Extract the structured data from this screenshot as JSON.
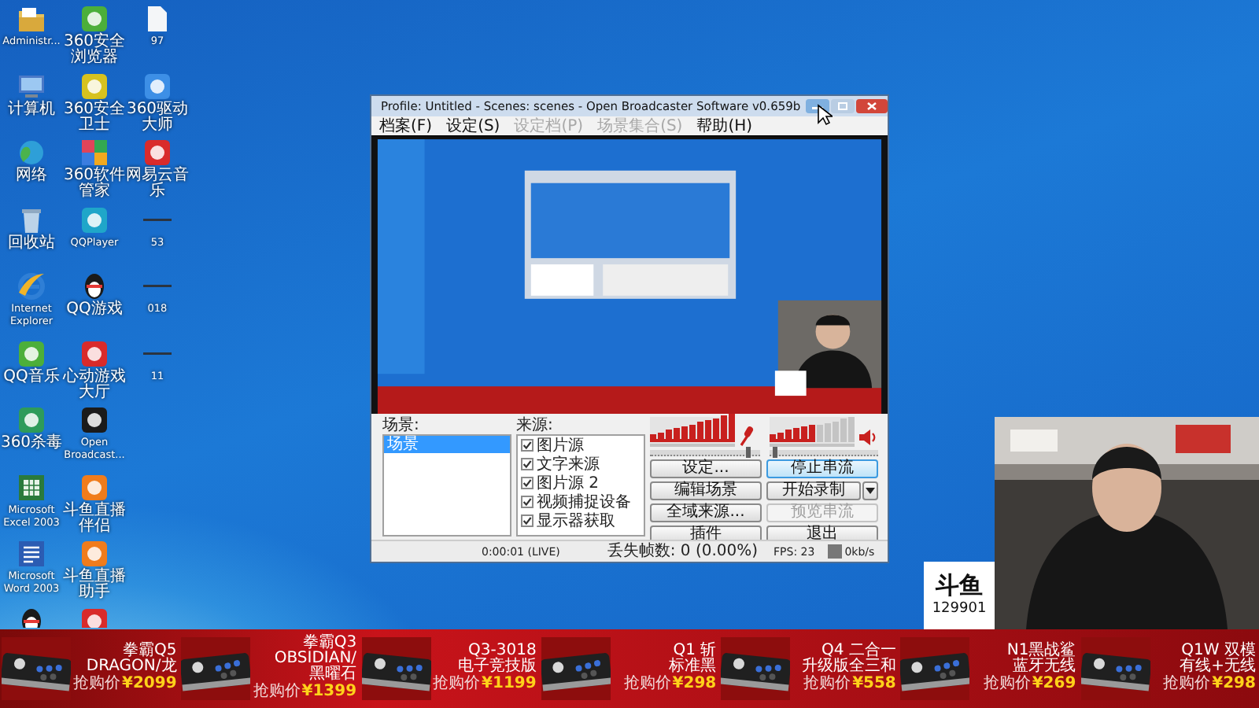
{
  "desktop": {
    "icon_columns": [
      {
        "icons": [
          {
            "kind": "folder",
            "label": "Administr..."
          },
          {
            "kind": "computer",
            "label": "计算机"
          },
          {
            "kind": "globe",
            "label": "网络"
          },
          {
            "kind": "bin",
            "label": "回收站"
          },
          {
            "kind": "ie",
            "label": "Internet Explorer"
          },
          {
            "kind": "green",
            "label": "QQ音乐"
          },
          {
            "kind": "gapp",
            "label": "360杀毒"
          },
          {
            "kind": "excel",
            "label": "Microsoft Excel 2003"
          },
          {
            "kind": "word",
            "label": "Microsoft Word 2003"
          },
          {
            "kind": "penguin"
          }
        ]
      },
      {
        "icons": [
          {
            "kind": "green",
            "label": "360安全浏览器"
          },
          {
            "kind": "yellow",
            "label": "360安全卫士"
          },
          {
            "kind": "tiles",
            "label": "360软件管家"
          },
          {
            "kind": "cyan",
            "label": "QQPlayer"
          },
          {
            "kind": "penguin",
            "label": "QQ游戏"
          },
          {
            "kind": "red",
            "label": "心动游戏大厅"
          },
          {
            "kind": "dark",
            "label": "Open Broadcast..."
          },
          {
            "kind": "orange",
            "label": "斗鱼直播伴侣"
          },
          {
            "kind": "orange",
            "label": "斗鱼直播助手"
          },
          {
            "kind": "red"
          }
        ]
      },
      {
        "icons": [
          {
            "kind": "file",
            "label": "97"
          },
          {
            "kind": "blue",
            "label": "360驱动大师"
          },
          {
            "kind": "red",
            "label": "网易云音乐"
          },
          {
            "kind": "dash",
            "label": "53"
          },
          {
            "kind": "dash",
            "label": "018"
          },
          {
            "kind": "dash",
            "label": "11"
          }
        ]
      }
    ]
  },
  "obs_window": {
    "title": "Profile: Untitled - Scenes: scenes - Open Broadcaster Software v0.659b",
    "menu": [
      {
        "label": "档案(F)",
        "disabled": false
      },
      {
        "label": "设定(S)",
        "disabled": false
      },
      {
        "label": "设定档(P)",
        "disabled": true
      },
      {
        "label": "场景集合(S)",
        "disabled": true
      },
      {
        "label": "帮助(H)",
        "disabled": false
      }
    ],
    "scenes": {
      "label": "场景:",
      "items": [
        {
          "label": "场景",
          "selected": true
        }
      ]
    },
    "sources": {
      "label": "来源:",
      "items": [
        {
          "label": "图片源",
          "checked": true
        },
        {
          "label": "文字来源",
          "checked": true
        },
        {
          "label": "图片源 2",
          "checked": true
        },
        {
          "label": "视频捕捉设备",
          "checked": true
        },
        {
          "label": "显示器获取",
          "checked": true
        }
      ]
    },
    "audio": [
      {
        "kind": "mic",
        "meter": {
          "level": 1
        },
        "slider": {
          "level": 0.88
        }
      },
      {
        "kind": "speaker",
        "meter": {
          "level": 0.55
        },
        "slider": {
          "level": 0.03
        }
      }
    ],
    "buttons": [
      {
        "label": "设定...",
        "kind": "plain",
        "focused": false,
        "disabled": false
      },
      {
        "label": "停止串流",
        "kind": "plain",
        "focused": true,
        "disabled": false
      },
      {
        "label": "编辑场景",
        "kind": "plain",
        "focused": false,
        "disabled": false
      },
      {
        "label": "开始录制",
        "kind": "split",
        "focused": false,
        "disabled": false
      },
      {
        "label": "全域来源...",
        "kind": "plain",
        "focused": false,
        "disabled": false
      },
      {
        "label": "预览串流",
        "kind": "plain",
        "focused": false,
        "disabled": true
      },
      {
        "label": "插件",
        "kind": "plain",
        "focused": false,
        "disabled": false
      },
      {
        "label": "退出",
        "kind": "plain",
        "focused": false,
        "disabled": false
      }
    ],
    "status": {
      "time": "0:00:01 (LIVE)",
      "dropped": "丢失帧数: 0 (0.00%)",
      "fps": "FPS: 23",
      "bitrate": "0kb/s"
    }
  },
  "stream_overlay": {
    "logo": "斗鱼",
    "room_number": "129901"
  },
  "banner": {
    "products": [
      {
        "name_lines": [
          "拳霸Q5",
          "DRAGON/龙"
        ],
        "price_label": "抢购价",
        "price": "¥2099"
      },
      {
        "name_lines": [
          "拳霸Q3",
          "OBSIDIAN/",
          "黑曜石"
        ],
        "price_label": "抢购价",
        "price": "¥1399"
      },
      {
        "name_lines": [
          "Q3-3018",
          "电子竞技版"
        ],
        "price_label": "抢购价",
        "price": "¥1199"
      },
      {
        "name_lines": [
          "Q1 斩",
          "标准黑"
        ],
        "price_label": "抢购价",
        "price": "¥298"
      },
      {
        "name_lines": [
          "Q4 二合一",
          "升级版全三和"
        ],
        "price_label": "抢购价",
        "price": "¥558"
      },
      {
        "name_lines": [
          "N1黑战鲨",
          "蓝牙无线"
        ],
        "price_label": "抢购价",
        "price": "¥269"
      },
      {
        "name_lines": [
          "Q1W 双模",
          "有线+无线"
        ],
        "price_label": "抢购价",
        "price": "¥298"
      }
    ]
  }
}
